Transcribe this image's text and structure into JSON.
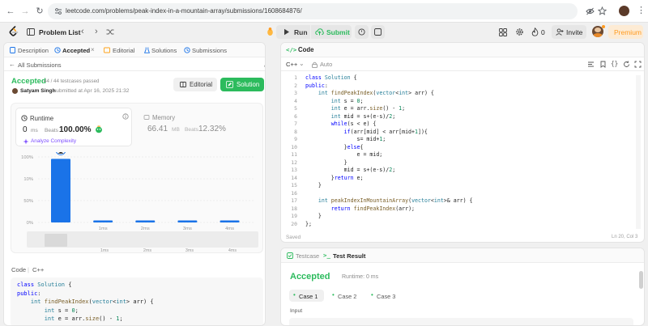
{
  "browser": {
    "url": "leetcode.com/problems/peak-index-in-a-mountain-array/submissions/1608684876/",
    "back": "←",
    "forward": "→",
    "reload": "↻"
  },
  "nav": {
    "problem_list": "Problem List",
    "run": "Run",
    "submit": "Submit",
    "coins": "0",
    "invite": "Invite",
    "premium": "Premium"
  },
  "left_tabs": [
    "Description",
    "Accepted",
    "Editorial",
    "Solutions",
    "Submissions"
  ],
  "submission": {
    "all_submissions": "All Submissions",
    "status": "Accepted",
    "testcases": "44 / 44 testcases passed",
    "user": "Satyam Singh",
    "submitted_at": "submitted at Apr 16, 2025 21:32",
    "editorial_btn": "Editorial",
    "solution_btn": "Solution",
    "runtime_label": "Runtime",
    "runtime_value": "0",
    "runtime_unit": "ms",
    "beats_label": "Beats",
    "runtime_beats": "100.00%",
    "analyze": "Analyze Complexity",
    "memory_label": "Memory",
    "memory_value": "66.41",
    "memory_unit": "MB",
    "memory_beats": "12.32%",
    "code_label": "Code",
    "code_lang": "C++"
  },
  "chart_data": {
    "type": "bar",
    "y_ticks": [
      "100%",
      "10%",
      "50%",
      "0%"
    ],
    "categories": [
      "",
      "1ms",
      "2ms",
      "3ms",
      "4ms"
    ],
    "values": [
      97,
      2,
      2,
      2,
      2
    ],
    "scrubber_ticks": [
      "1ms",
      "2ms",
      "3ms",
      "4ms"
    ],
    "ylim": [
      0,
      100
    ],
    "highlight_index": 0,
    "colors": {
      "bar": "#1a73e8",
      "accent": "#2cbb5d"
    }
  },
  "editor": {
    "title": "Code",
    "lang": "C++",
    "mode": "Auto",
    "saved": "Saved",
    "cursor": "Ln 20, Col 3",
    "lines": [
      "class Solution {",
      "public:",
      "    int findPeakIndex(vector<int> arr) {",
      "        int s = 0;",
      "        int e = arr.size() - 1;",
      "        int mid = s+(e-s)/2;",
      "        while(s < e) {",
      "            if(arr[mid] < arr[mid+1]){",
      "                s= mid+1;",
      "            }else{",
      "                e = mid;",
      "            }",
      "            mid = s+(e-s)/2;",
      "        }return e;",
      "    }",
      "",
      "    int peakIndexInMountainArray(vector<int>& arr) {",
      "        return findPeakIndex(arr);",
      "    }",
      "};"
    ]
  },
  "preview_code": [
    "class Solution {",
    "public:",
    "    int findPeakIndex(vector<int> arr) {",
    "        int s = 0;",
    "        int e = arr.size() - 1;"
  ],
  "result": {
    "testcase_tab": "Testcase",
    "result_tab": "Test Result",
    "status": "Accepted",
    "runtime": "Runtime: 0 ms",
    "cases": [
      "Case 1",
      "Case 2",
      "Case 3"
    ],
    "input_label": "Input"
  }
}
